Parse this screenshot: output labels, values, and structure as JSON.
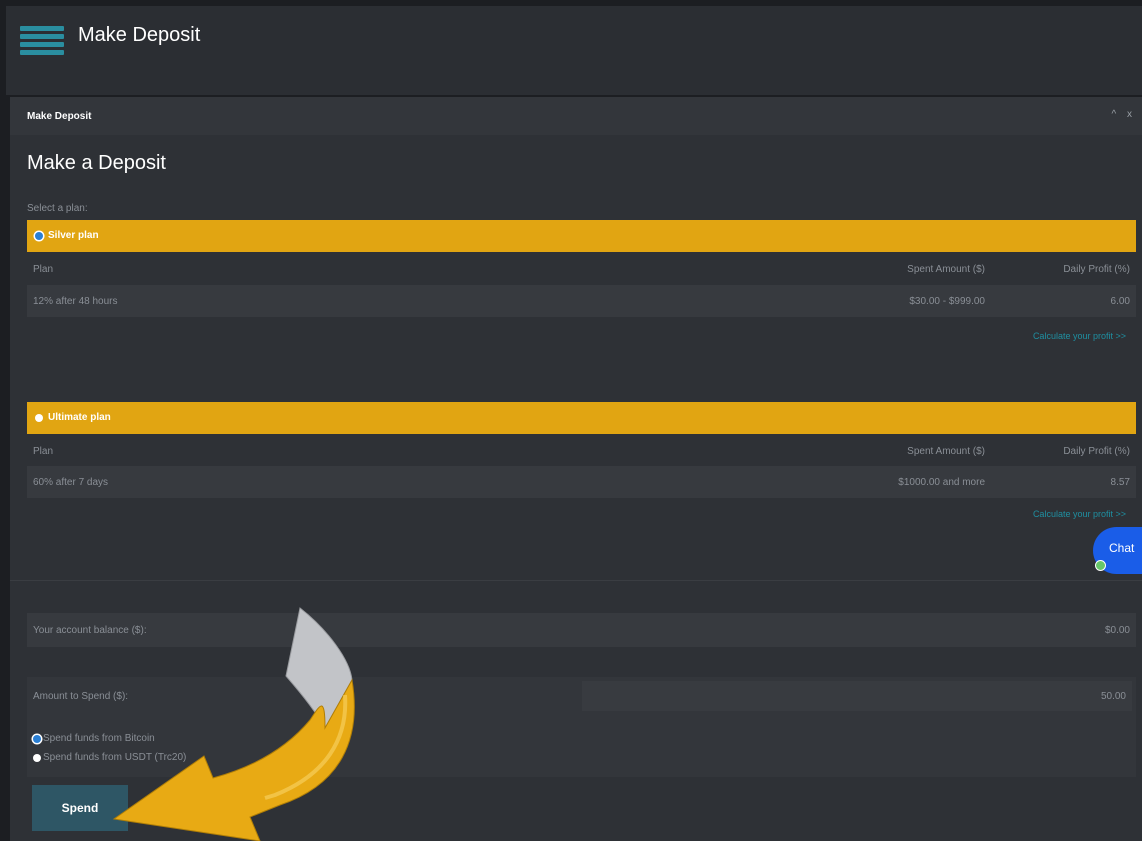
{
  "topbar": {
    "title": "Make Deposit"
  },
  "panel": {
    "header_label": "Make Deposit",
    "tools": [
      "^",
      "x"
    ],
    "heading": "Make a Deposit",
    "select_plan_label": "Select a plan:"
  },
  "plans": [
    {
      "name": "Silver plan",
      "selected": true,
      "headers": {
        "plan": "Plan",
        "amount": "Spent Amount ($)",
        "profit": "Daily Profit (%)"
      },
      "row": {
        "plan": "12% after 48 hours",
        "amount": "$30.00 - $999.00",
        "profit": "6.00"
      },
      "calc_link": "Calculate your profit >>"
    },
    {
      "name": "Ultimate plan",
      "selected": false,
      "headers": {
        "plan": "Plan",
        "amount": "Spent Amount ($)",
        "profit": "Daily Profit (%)"
      },
      "row": {
        "plan": "60% after 7 days",
        "amount": "$1000.00 and more",
        "profit": "8.57"
      },
      "calc_link": "Calculate your profit >>"
    }
  ],
  "chat": {
    "label": "Chat"
  },
  "balance": {
    "label": "Your account balance ($):",
    "value": "$0.00"
  },
  "amount": {
    "label": "Amount to Spend ($):",
    "value": "50.00"
  },
  "sources": [
    {
      "label": "Spend funds from Bitcoin",
      "selected": true
    },
    {
      "label": "Spend funds from USDT (Trc20)",
      "selected": false
    }
  ],
  "spend_button": "Spend",
  "colors": {
    "background": "#1c1e22",
    "panel": "#2e3136",
    "plan_bar": "#e1a512",
    "link": "#1f8fa1",
    "chat": "#1a5de8",
    "button": "#2e5665",
    "arrow": "#e8aa14"
  }
}
